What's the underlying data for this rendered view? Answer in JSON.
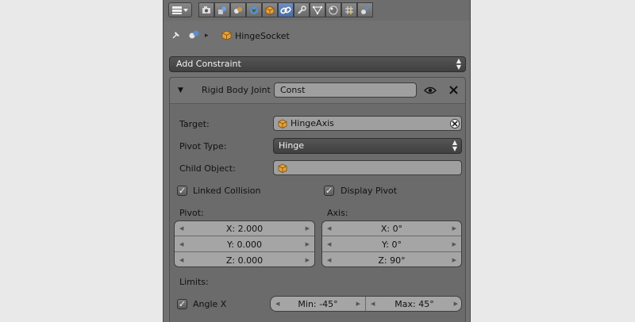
{
  "header": {
    "tab_icons": [
      "editor-type-icon",
      "render-icon",
      "render-layers-icon",
      "scene-icon",
      "world-icon",
      "object-icon",
      "constraints-icon",
      "modifiers-icon",
      "data-icon",
      "material-icon",
      "particles-icon",
      "physics-icon"
    ],
    "active_tab": "constraints-icon"
  },
  "context": {
    "object_name": "HingeSocket"
  },
  "add_constraint": {
    "label": "Add Constraint"
  },
  "constraint": {
    "type_label": "Rigid Body Joint",
    "name_value": "Const",
    "target_label": "Target:",
    "target_value": "HingeAxis",
    "pivot_type_label": "Pivot Type:",
    "pivot_type_value": "Hinge",
    "child_object_label": "Child Object:",
    "child_object_value": "",
    "linked_collision": {
      "label": "Linked Collision",
      "checked": true
    },
    "display_pivot": {
      "label": "Display Pivot",
      "checked": true
    },
    "pivot": {
      "label": "Pivot:",
      "x": "X: 2.000",
      "y": "Y: 0.000",
      "z": "Z: 0.000"
    },
    "axis": {
      "label": "Axis:",
      "x": "X: 0°",
      "y": "Y: 0°",
      "z": "Z: 90°"
    },
    "limits_label": "Limits:",
    "angle_x": {
      "label": "Angle X",
      "checked": true,
      "min": "Min: -45°",
      "max": "Max: 45°"
    }
  },
  "colors": {
    "panel_bg": "#727272",
    "active_tab": "#4b6da6",
    "field_bg": "#9f9f9f",
    "object_icon": "#e8a23a"
  }
}
